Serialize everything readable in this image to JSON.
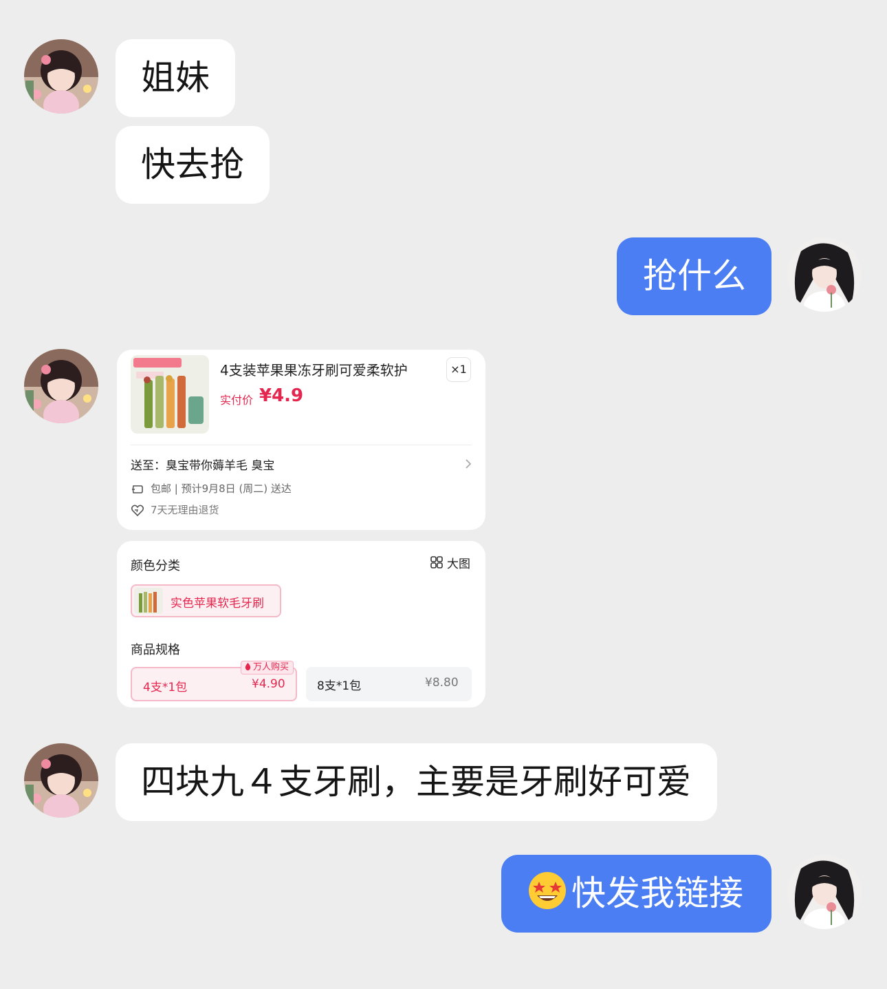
{
  "messages": [
    {
      "side": "in",
      "text": "姐妹"
    },
    {
      "side": "in",
      "text": "快去抢"
    },
    {
      "side": "out",
      "text": "抢什么"
    },
    {
      "side": "in",
      "text": "四块九４支牙刷，主要是牙刷好可爱"
    },
    {
      "side": "out",
      "emoji": "star-struck-emoji",
      "text": "快发我链接"
    }
  ],
  "product_card": {
    "title": "4支装苹果果冻牙刷可爱柔软护",
    "quantity": "×1",
    "price_label": "实付价",
    "price": "¥4.9",
    "address_label": "送至：",
    "address": "臭宝带你薅羊毛  臭宝",
    "shipping": "包邮 | 预计9月8日 (周二) 送达",
    "return_policy": "7天无理由退货",
    "color_section_title": "颜色分类",
    "big_image_label": "大图",
    "color_option": "实色苹果软毛牙刷",
    "spec_section_title": "商品规格",
    "hot_badge": "万人购买",
    "specs": [
      {
        "name": "4支*1包",
        "price": "¥4.90",
        "selected": true
      },
      {
        "name": "8支*1包",
        "price": "¥8.80",
        "selected": false
      }
    ],
    "accent_color": "#e5274f"
  },
  "colors": {
    "background": "#ededed",
    "incoming_bubble": "#ffffff",
    "outgoing_bubble": "#4b7ef3"
  }
}
